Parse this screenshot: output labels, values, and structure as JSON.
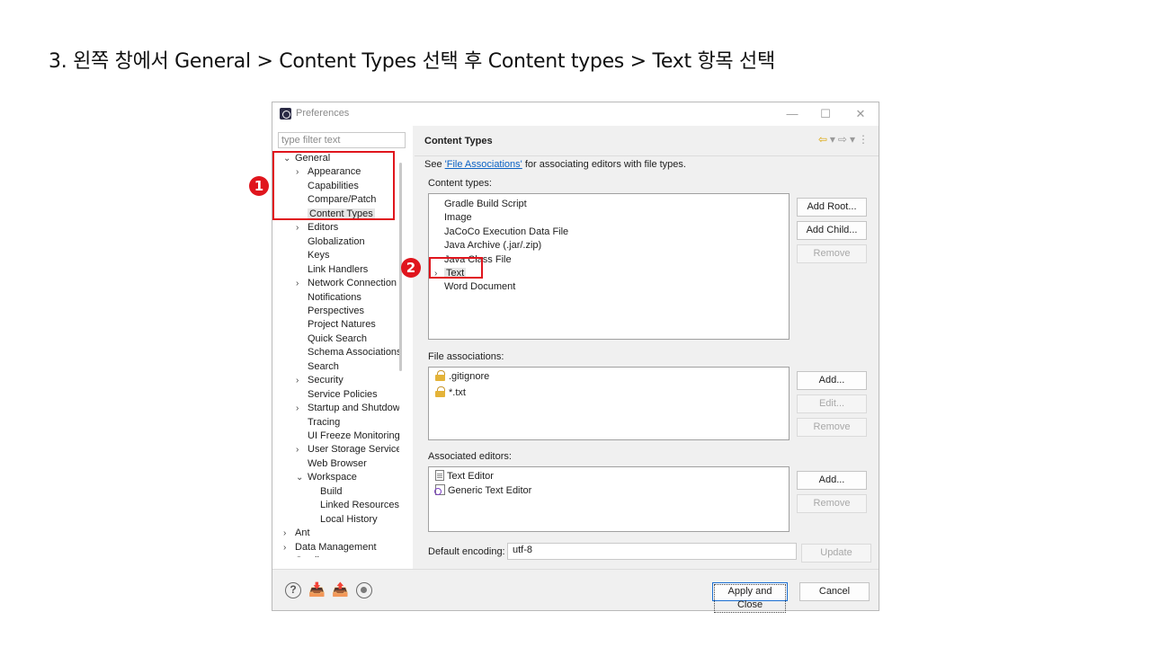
{
  "slide": {
    "instruction": "3. 왼쪽 창에서 General > Content Types 선택 후 Content types > Text  항목 선택"
  },
  "window": {
    "title": "Preferences",
    "min_glyph": "—",
    "max_glyph": "☐",
    "close_glyph": "✕"
  },
  "left": {
    "filter_placeholder": "type filter text",
    "tree": [
      {
        "label": "General",
        "depth": 0,
        "arrow": "⌄"
      },
      {
        "label": "Appearance",
        "depth": 1,
        "arrow": "›"
      },
      {
        "label": "Capabilities",
        "depth": 1,
        "arrow": ""
      },
      {
        "label": "Compare/Patch",
        "depth": 1,
        "arrow": ""
      },
      {
        "label": "Content Types",
        "depth": 1,
        "arrow": "",
        "selected": true
      },
      {
        "label": "Editors",
        "depth": 1,
        "arrow": "›"
      },
      {
        "label": "Globalization",
        "depth": 1,
        "arrow": ""
      },
      {
        "label": "Keys",
        "depth": 1,
        "arrow": ""
      },
      {
        "label": "Link Handlers",
        "depth": 1,
        "arrow": ""
      },
      {
        "label": "Network Connection",
        "depth": 1,
        "arrow": "›"
      },
      {
        "label": "Notifications",
        "depth": 1,
        "arrow": ""
      },
      {
        "label": "Perspectives",
        "depth": 1,
        "arrow": ""
      },
      {
        "label": "Project Natures",
        "depth": 1,
        "arrow": ""
      },
      {
        "label": "Quick Search",
        "depth": 1,
        "arrow": ""
      },
      {
        "label": "Schema Associations",
        "depth": 1,
        "arrow": ""
      },
      {
        "label": "Search",
        "depth": 1,
        "arrow": ""
      },
      {
        "label": "Security",
        "depth": 1,
        "arrow": "›"
      },
      {
        "label": "Service Policies",
        "depth": 1,
        "arrow": ""
      },
      {
        "label": "Startup and Shutdow",
        "depth": 1,
        "arrow": "›"
      },
      {
        "label": "Tracing",
        "depth": 1,
        "arrow": ""
      },
      {
        "label": "UI Freeze Monitoring",
        "depth": 1,
        "arrow": ""
      },
      {
        "label": "User Storage Service",
        "depth": 1,
        "arrow": "›"
      },
      {
        "label": "Web Browser",
        "depth": 1,
        "arrow": ""
      },
      {
        "label": "Workspace",
        "depth": 1,
        "arrow": "⌄"
      },
      {
        "label": "Build",
        "depth": 2,
        "arrow": ""
      },
      {
        "label": "Linked Resources",
        "depth": 2,
        "arrow": ""
      },
      {
        "label": "Local History",
        "depth": 2,
        "arrow": ""
      },
      {
        "label": "Ant",
        "depth": 0,
        "arrow": "›"
      },
      {
        "label": "Data Management",
        "depth": 0,
        "arrow": "›"
      },
      {
        "label": "Gradle",
        "depth": 0,
        "arrow": "›"
      }
    ]
  },
  "right": {
    "title": "Content Types",
    "nav": {
      "back": "⇦",
      "dropdown": "▾",
      "forward": "⇨",
      "menu": "⋮"
    },
    "see_prefix": "See ",
    "see_link": "'File Associations'",
    "see_suffix": " for associating editors with file types.",
    "content_types_label": "Content types:",
    "content_types": [
      {
        "label": "Gradle Build Script",
        "arrow": ""
      },
      {
        "label": "Image",
        "arrow": ""
      },
      {
        "label": "JaCoCo Execution Data File",
        "arrow": ""
      },
      {
        "label": "Java Archive (.jar/.zip)",
        "arrow": ""
      },
      {
        "label": "Java Class File",
        "arrow": ""
      },
      {
        "label": "Text",
        "arrow": "›",
        "selected": true
      },
      {
        "label": "Word Document",
        "arrow": ""
      }
    ],
    "add_root": "Add Root...",
    "add_child": "Add Child...",
    "remove": "Remove",
    "file_assoc_label": "File associations:",
    "file_associations": [
      ".gitignore",
      "*.txt"
    ],
    "add": "Add...",
    "edit": "Edit...",
    "assoc_editors_label": "Associated editors:",
    "associated_editors": [
      "Text Editor",
      "Generic Text Editor"
    ],
    "encoding_label": "Default encoding:",
    "encoding_value": "utf-8",
    "update": "Update"
  },
  "footer": {
    "apply_close": "Apply and Close",
    "cancel": "Cancel"
  },
  "annotations": {
    "first": "1",
    "second": "2",
    "color": "#e0151d"
  }
}
